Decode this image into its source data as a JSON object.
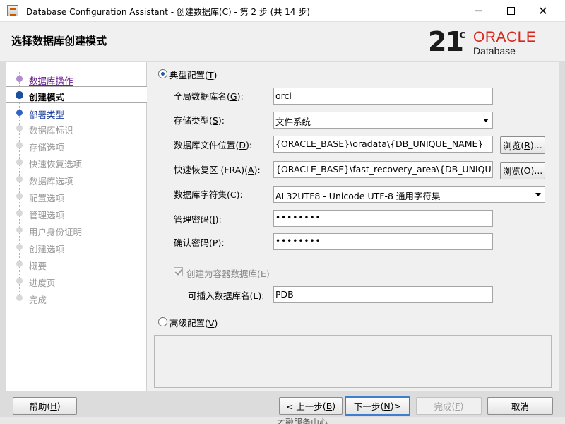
{
  "window": {
    "title": "Database Configuration Assistant - 创建数据库(C) - 第 2 步 (共 14 步)",
    "minimize": "─",
    "close": "✕"
  },
  "header": {
    "title": "选择数据库创建模式",
    "logo": {
      "version": "21",
      "suffix": "c",
      "brand": "ORACLE",
      "product": "Database"
    }
  },
  "steps": [
    {
      "label": "数据库操作",
      "state": "visited"
    },
    {
      "label": "创建模式",
      "state": "current"
    },
    {
      "label": "部署类型",
      "state": "next"
    },
    {
      "label": "数据库标识",
      "state": "disabled"
    },
    {
      "label": "存储选项",
      "state": "disabled"
    },
    {
      "label": "快速恢复选项",
      "state": "disabled"
    },
    {
      "label": "数据库选项",
      "state": "disabled"
    },
    {
      "label": "配置选项",
      "state": "disabled"
    },
    {
      "label": "管理选项",
      "state": "disabled"
    },
    {
      "label": "用户身份证明",
      "state": "disabled"
    },
    {
      "label": "创建选项",
      "state": "disabled"
    },
    {
      "label": "概要",
      "state": "disabled"
    },
    {
      "label": "进度页",
      "state": "disabled"
    },
    {
      "label": "完成",
      "state": "disabled"
    }
  ],
  "form": {
    "typical": {
      "label": "典型配置",
      "mnemonic": "T",
      "selected": true
    },
    "global_db_name": {
      "label": "全局数据库名",
      "mnemonic": "G",
      "value": "orcl"
    },
    "storage_type": {
      "label": "存储类型",
      "mnemonic": "S",
      "value": "文件系统"
    },
    "db_file_location": {
      "label": "数据库文件位置",
      "mnemonic": "D",
      "value": "{ORACLE_BASE}\\oradata\\{DB_UNIQUE_NAME}",
      "browse": "浏览",
      "browse_mnemonic": "R"
    },
    "fra": {
      "label": "快速恢复区 (FRA)",
      "mnemonic": "A",
      "value": "{ORACLE_BASE}\\fast_recovery_area\\{DB_UNIQUE_NAME}",
      "browse": "浏览",
      "browse_mnemonic": "O"
    },
    "charset": {
      "label": "数据库字符集",
      "mnemonic": "C",
      "value": "AL32UTF8 - Unicode UTF-8 通用字符集"
    },
    "admin_password": {
      "label": "管理密码",
      "mnemonic": "I",
      "value": "••••••••"
    },
    "confirm_password": {
      "label": "确认密码",
      "mnemonic": "P",
      "value": "••••••••"
    },
    "container_db": {
      "label": "创建为容器数据库",
      "mnemonic": "E",
      "checked": true,
      "enabled": false
    },
    "pdb_name": {
      "label": "可插入数据库名",
      "mnemonic": "L",
      "value": "PDB"
    },
    "advanced": {
      "label": "高级配置",
      "mnemonic": "V",
      "selected": false
    }
  },
  "buttons": {
    "help": {
      "label": "帮助",
      "mnemonic": "H"
    },
    "back": {
      "label": "< 上一步",
      "mnemonic": "B"
    },
    "next": {
      "label": "下一步",
      "mnemonic": "N",
      "suffix": " >"
    },
    "finish": {
      "label": "完成",
      "mnemonic": "F"
    },
    "cancel": {
      "label": "取消"
    }
  },
  "background": {
    "text": "才融服务由心"
  }
}
